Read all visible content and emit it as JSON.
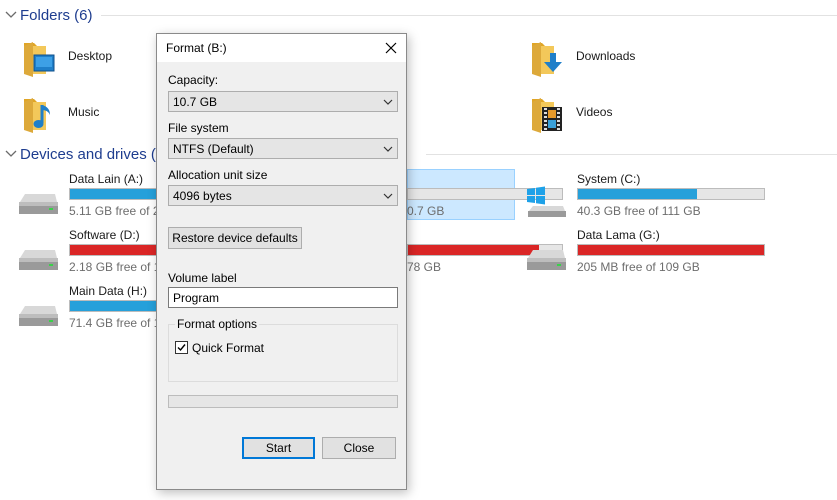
{
  "folders_section": {
    "title": "Folders (6)"
  },
  "folders": [
    {
      "label": "Desktop",
      "icon": "desktop-folder-icon"
    },
    {
      "label": "Downloads",
      "icon": "downloads-folder-icon"
    },
    {
      "label": "Music",
      "icon": "music-folder-icon"
    },
    {
      "label": "Videos",
      "icon": "videos-folder-icon"
    }
  ],
  "drives_section": {
    "title": "Devices and drives ("
  },
  "drives": {
    "a": {
      "name": "Data Lain (A:)",
      "free": "5.11 GB free of 2",
      "used_fraction": 0.97,
      "bar_color": "#26a0da"
    },
    "d": {
      "name": "Software (D:)",
      "free": "2.18 GB free of 1",
      "used_fraction": 0.98,
      "bar_color": "#da2626"
    },
    "h": {
      "name": "Main Data (H:)",
      "free": "71.4 GB free of 1",
      "used_fraction": 0.55,
      "bar_color": "#26a0da"
    },
    "b_partial": {
      "free": "0.7 GB",
      "used_fraction": 0.0,
      "bar_color": "#26a0da"
    },
    "e_partial": {
      "free": "78 GB",
      "used_fraction": 0.85,
      "bar_color": "#da2626"
    },
    "c": {
      "name": "System (C:)",
      "free": "40.3 GB free of 111 GB",
      "used_fraction": 0.64,
      "bar_color": "#26a0da"
    },
    "g": {
      "name": "Data Lama (G:)",
      "free": "205 MB free of 109 GB",
      "used_fraction": 0.998,
      "bar_color": "#da2626"
    }
  },
  "dialog": {
    "title": "Format  (B:)",
    "capacity_label": "Capacity:",
    "capacity_value": "10.7 GB",
    "filesystem_label": "File system",
    "filesystem_value": "NTFS (Default)",
    "alloc_label": "Allocation unit size",
    "alloc_value": "4096 bytes",
    "restore_label": "Restore device defaults",
    "volume_label": "Volume label",
    "volume_value": "Program",
    "format_options_label": "Format options",
    "quick_format_label": "Quick Format",
    "quick_format_checked": true,
    "start_label": "Start",
    "close_label": "Close"
  },
  "colors": {
    "accent": "#0078d7",
    "header_blue": "#1e3d8f",
    "bar_blue": "#26a0da",
    "bar_red": "#da2626"
  }
}
